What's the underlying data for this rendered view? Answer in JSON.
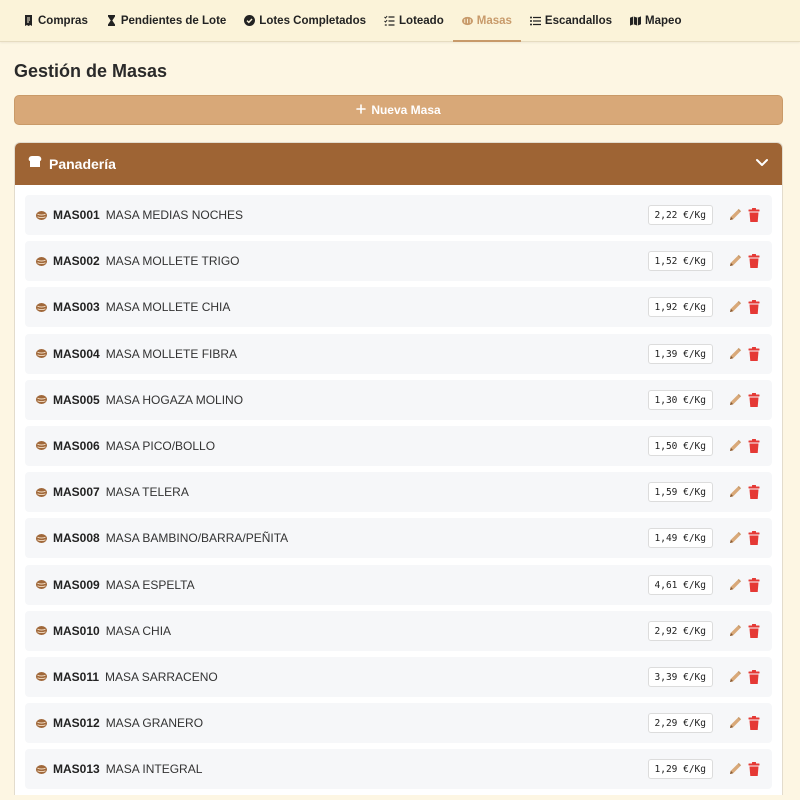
{
  "nav": {
    "tabs": [
      {
        "label": "Compras",
        "icon": "receipt-icon"
      },
      {
        "label": "Pendientes de Lote",
        "icon": "hourglass-icon"
      },
      {
        "label": "Lotes Completados",
        "icon": "check-circle-icon"
      },
      {
        "label": "Loteado",
        "icon": "list-check-icon"
      },
      {
        "label": "Masas",
        "icon": "bread-icon",
        "active": true
      },
      {
        "label": "Escandallos",
        "icon": "list-icon"
      },
      {
        "label": "Mapeo",
        "icon": "map-icon"
      }
    ]
  },
  "page": {
    "title": "Gestión de Masas",
    "new_button_label": "Nueva Masa"
  },
  "category": {
    "name": "Panadería",
    "icon": "bread-loaf-icon",
    "items": [
      {
        "code": "MAS001",
        "name": "MASA MEDIAS NOCHES",
        "price": "2,22 €/Kg"
      },
      {
        "code": "MAS002",
        "name": "MASA MOLLETE TRIGO",
        "price": "1,52 €/Kg"
      },
      {
        "code": "MAS003",
        "name": "MASA MOLLETE CHIA",
        "price": "1,92 €/Kg"
      },
      {
        "code": "MAS004",
        "name": "MASA MOLLETE FIBRA",
        "price": "1,39 €/Kg"
      },
      {
        "code": "MAS005",
        "name": "MASA HOGAZA MOLINO",
        "price": "1,30 €/Kg"
      },
      {
        "code": "MAS006",
        "name": "MASA PICO/BOLLO",
        "price": "1,50 €/Kg"
      },
      {
        "code": "MAS007",
        "name": "MASA TELERA",
        "price": "1,59 €/Kg"
      },
      {
        "code": "MAS008",
        "name": "MASA BAMBINO/BARRA/PEÑITA",
        "price": "1,49 €/Kg"
      },
      {
        "code": "MAS009",
        "name": "MASA ESPELTA",
        "price": "4,61 €/Kg"
      },
      {
        "code": "MAS010",
        "name": "MASA CHIA",
        "price": "2,92 €/Kg"
      },
      {
        "code": "MAS011",
        "name": "MASA SARRACENO",
        "price": "3,39 €/Kg"
      },
      {
        "code": "MAS012",
        "name": "MASA GRANERO",
        "price": "2,29 €/Kg"
      },
      {
        "code": "MAS013",
        "name": "MASA INTEGRAL",
        "price": "1,29 €/Kg"
      }
    ]
  },
  "colors": {
    "accent": "#c89a6a",
    "category_header": "#9e6434",
    "button": "#d8a878",
    "delete": "#e53935",
    "edit": "#c89a6a",
    "item_icon": "#a0683a"
  }
}
